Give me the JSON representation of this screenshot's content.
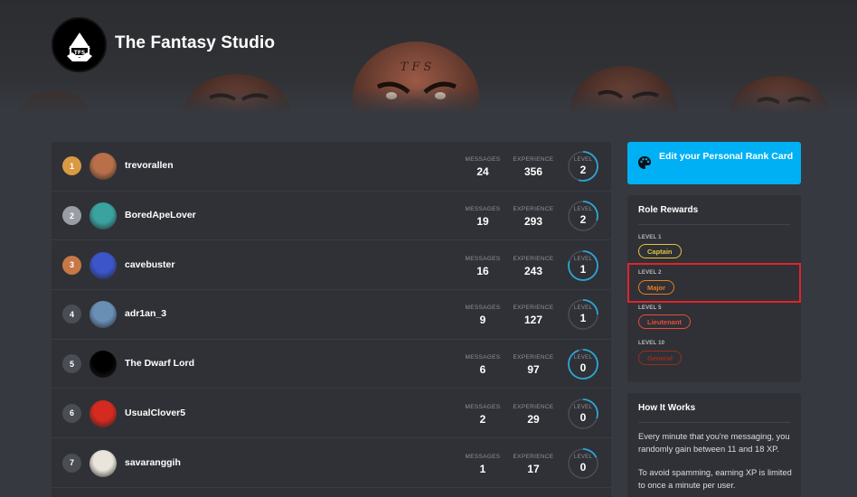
{
  "server": {
    "name": "The Fantasy Studio",
    "logo_icon": "tfs-dwarf-logo-icon"
  },
  "leaderboard": {
    "stat_labels": {
      "messages": "MESSAGES",
      "experience": "EXPERIENCE",
      "level": "LEVEL"
    },
    "rows": [
      {
        "rank": "1",
        "username": "trevorallen",
        "messages": "24",
        "experience": "356",
        "level": "2",
        "level_progress": 0.55,
        "rank_style": "gold",
        "avatar_color": "#b9704a"
      },
      {
        "rank": "2",
        "username": "BoredApeLover",
        "messages": "19",
        "experience": "293",
        "level": "2",
        "level_progress": 0.3,
        "rank_style": "silver",
        "avatar_color": "#3aa3a0"
      },
      {
        "rank": "3",
        "username": "cavebuster",
        "messages": "16",
        "experience": "243",
        "level": "1",
        "level_progress": 0.8,
        "rank_style": "bronze",
        "avatar_color": "#3c55c8"
      },
      {
        "rank": "4",
        "username": "adr1an_3",
        "messages": "9",
        "experience": "127",
        "level": "1",
        "level_progress": 0.25,
        "rank_style": "plain",
        "avatar_color": "#6a8fb5"
      },
      {
        "rank": "5",
        "username": "The Dwarf Lord",
        "messages": "6",
        "experience": "97",
        "level": "0",
        "level_progress": 0.95,
        "rank_style": "plain",
        "avatar_color": "#000000"
      },
      {
        "rank": "6",
        "username": "UsualClover5",
        "messages": "2",
        "experience": "29",
        "level": "0",
        "level_progress": 0.3,
        "rank_style": "plain",
        "avatar_color": "#d42a1f"
      },
      {
        "rank": "7",
        "username": "savaranggih",
        "messages": "1",
        "experience": "17",
        "level": "0",
        "level_progress": 0.18,
        "rank_style": "plain",
        "avatar_color": "#e9e4dc"
      }
    ]
  },
  "edit_card": {
    "label": "Edit your Personal Rank Card",
    "icon": "palette-icon",
    "color": "#00b0f4"
  },
  "role_rewards": {
    "title": "Role Rewards",
    "items": [
      {
        "level": "LEVEL 1",
        "role": "Captain",
        "color": "#e3c23f"
      },
      {
        "level": "LEVEL 2",
        "role": "Major",
        "color": "#e67e22"
      },
      {
        "level": "LEVEL 5",
        "role": "Lieutenant",
        "color": "#e74c3c"
      },
      {
        "level": "LEVEL 10",
        "role": "General",
        "color": "#992d22"
      }
    ]
  },
  "how_it_works": {
    "title": "How It Works",
    "paragraphs": [
      "Every minute that you're messaging, you randomly gain between 11 and 18 XP.",
      "To avoid spamming, earning XP is limited to once a minute per user."
    ]
  },
  "colors": {
    "background": "#36393f",
    "card": "#2f3136",
    "accent": "#00b0f4",
    "highlight": "#e0242a"
  }
}
